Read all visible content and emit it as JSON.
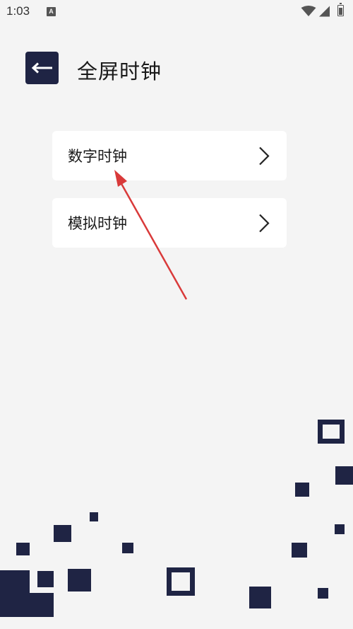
{
  "status_bar": {
    "time": "1:03",
    "notification_icon": "A"
  },
  "header": {
    "back_icon": "arrow-left-icon",
    "title": "全屏时钟"
  },
  "menu": {
    "items": [
      {
        "label": "数字时钟",
        "icon": "chevron-right-icon"
      },
      {
        "label": "模拟时钟",
        "icon": "chevron-right-icon"
      }
    ]
  },
  "colors": {
    "background": "#f4f4f4",
    "accent_navy": "#1f2444",
    "card": "#ffffff",
    "annotation_arrow": "#d93a3a"
  }
}
